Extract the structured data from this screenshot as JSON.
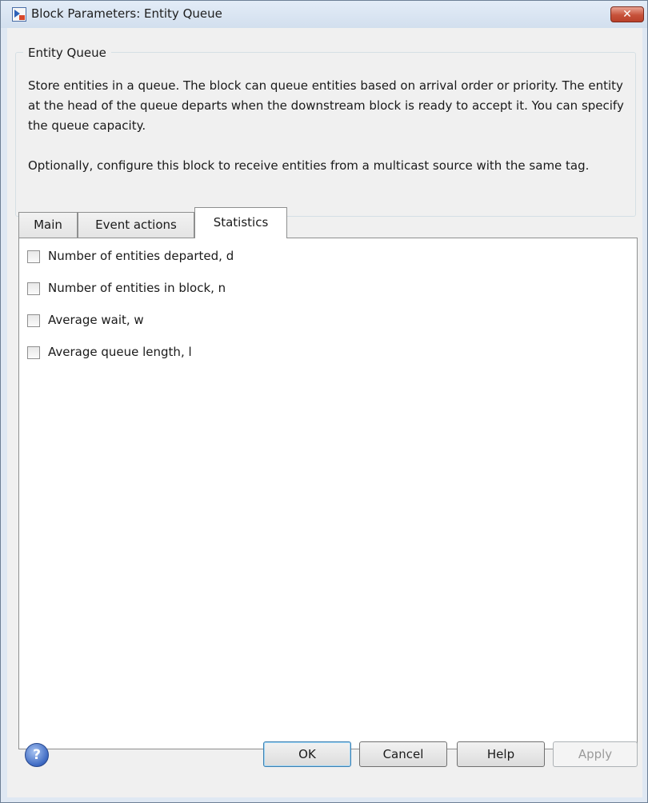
{
  "window": {
    "title": "Block Parameters: Entity Queue",
    "close_label": "✕"
  },
  "group": {
    "title": "Entity Queue",
    "description_1": "Store entities in a queue. The block can queue entities based on arrival order or priority. The entity at the head of the queue departs when the downstream block is ready to accept it. You can specify the queue capacity.",
    "description_2": "Optionally, configure this block to receive entities from a multicast source with the same tag."
  },
  "tabs": [
    {
      "label": "Main",
      "selected": false
    },
    {
      "label": "Event actions",
      "selected": false
    },
    {
      "label": "Statistics",
      "selected": true
    }
  ],
  "statistics": {
    "items": [
      {
        "label": "Number of entities departed, d",
        "checked": false
      },
      {
        "label": "Number of entities in block, n",
        "checked": false
      },
      {
        "label": "Average wait, w",
        "checked": false
      },
      {
        "label": "Average queue length, l",
        "checked": false
      }
    ]
  },
  "buttons": {
    "ok": "OK",
    "cancel": "Cancel",
    "help": "Help",
    "apply": "Apply",
    "apply_enabled": false
  },
  "icons": {
    "app": "block-icon",
    "help": "question-icon",
    "help_glyph": "?"
  }
}
